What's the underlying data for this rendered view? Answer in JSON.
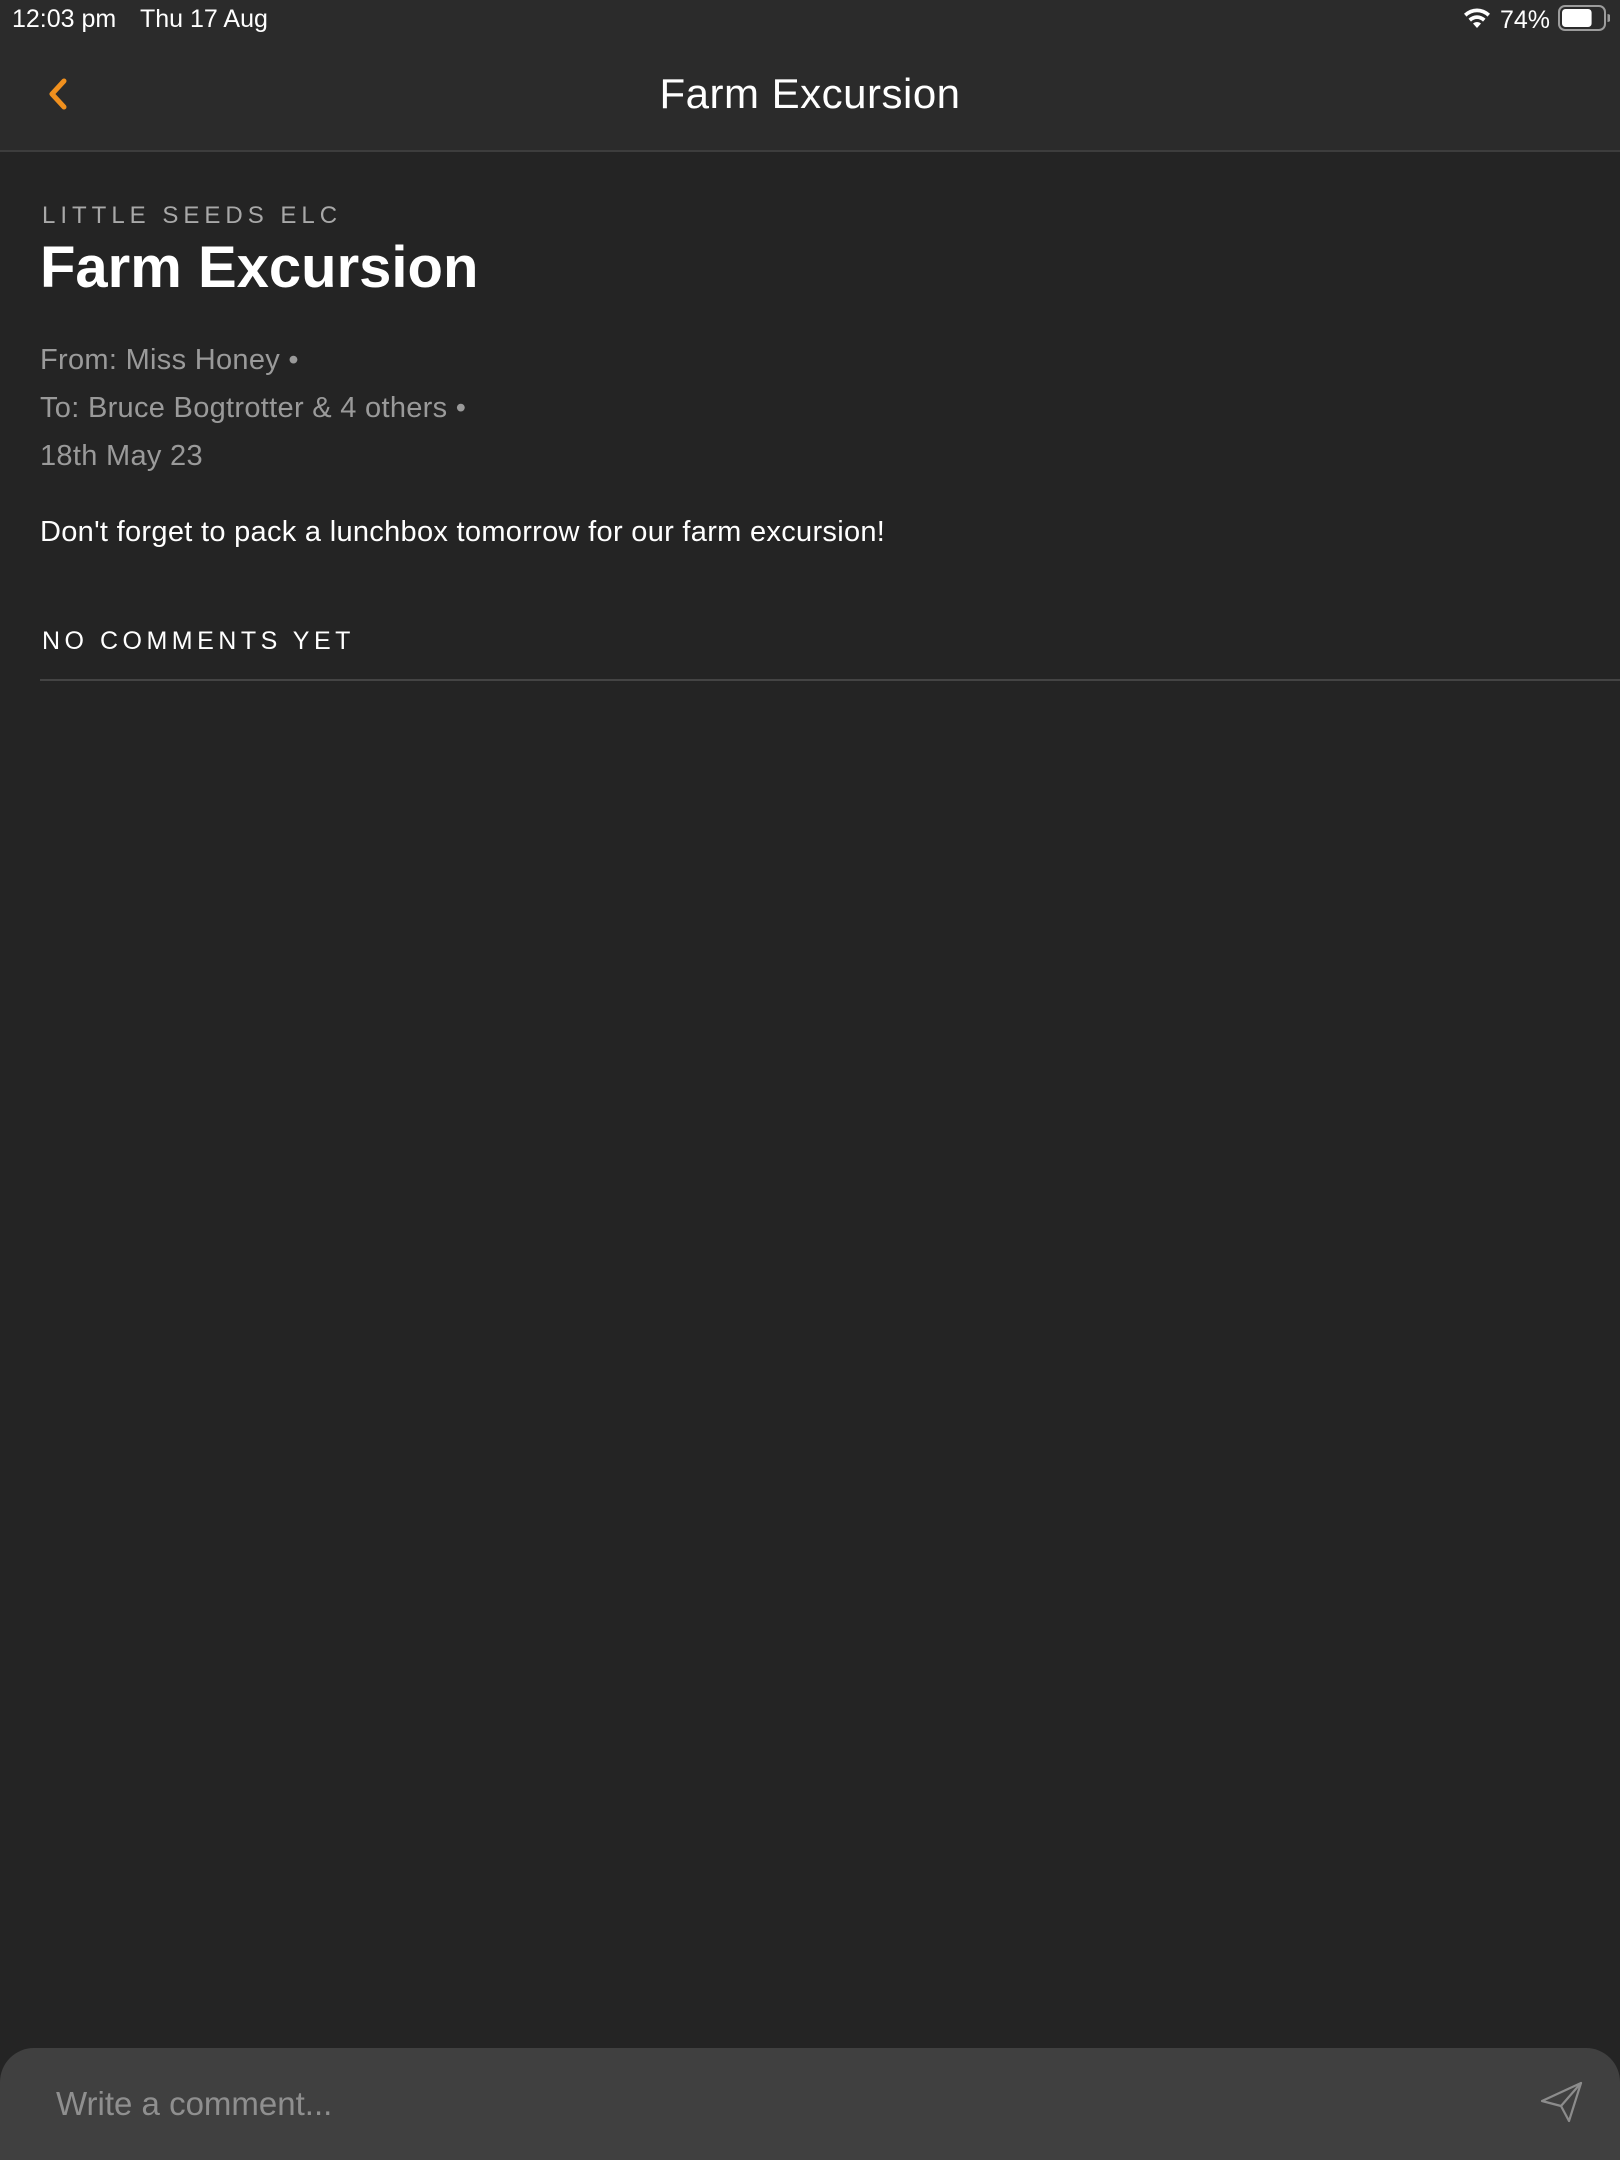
{
  "status_bar": {
    "time": "12:03 pm",
    "date": "Thu 17 Aug",
    "battery_percent": "74%",
    "battery_level": 0.74,
    "icons": [
      "wifi-icon",
      "battery-icon"
    ]
  },
  "nav": {
    "title": "Farm Excursion",
    "back_icon": "chevron-left-icon",
    "accent_color": "#f0901e"
  },
  "post": {
    "organization": "LITTLE SEEDS ELC",
    "title": "Farm Excursion",
    "from": "From: Miss Honey •",
    "to": "To: Bruce Bogtrotter & 4 others •",
    "date": "18th May 23",
    "body": "Don't forget to pack a lunchbox tomorrow for our farm excursion!"
  },
  "comments": {
    "header": "NO COMMENTS YET",
    "items": []
  },
  "comment_bar": {
    "placeholder": "Write a comment...",
    "value": "",
    "send_icon": "send-icon"
  },
  "colors": {
    "background": "#242424",
    "bar_background": "#2b2b2b",
    "input_background": "#404040",
    "secondary_text": "#9a9a9a"
  }
}
